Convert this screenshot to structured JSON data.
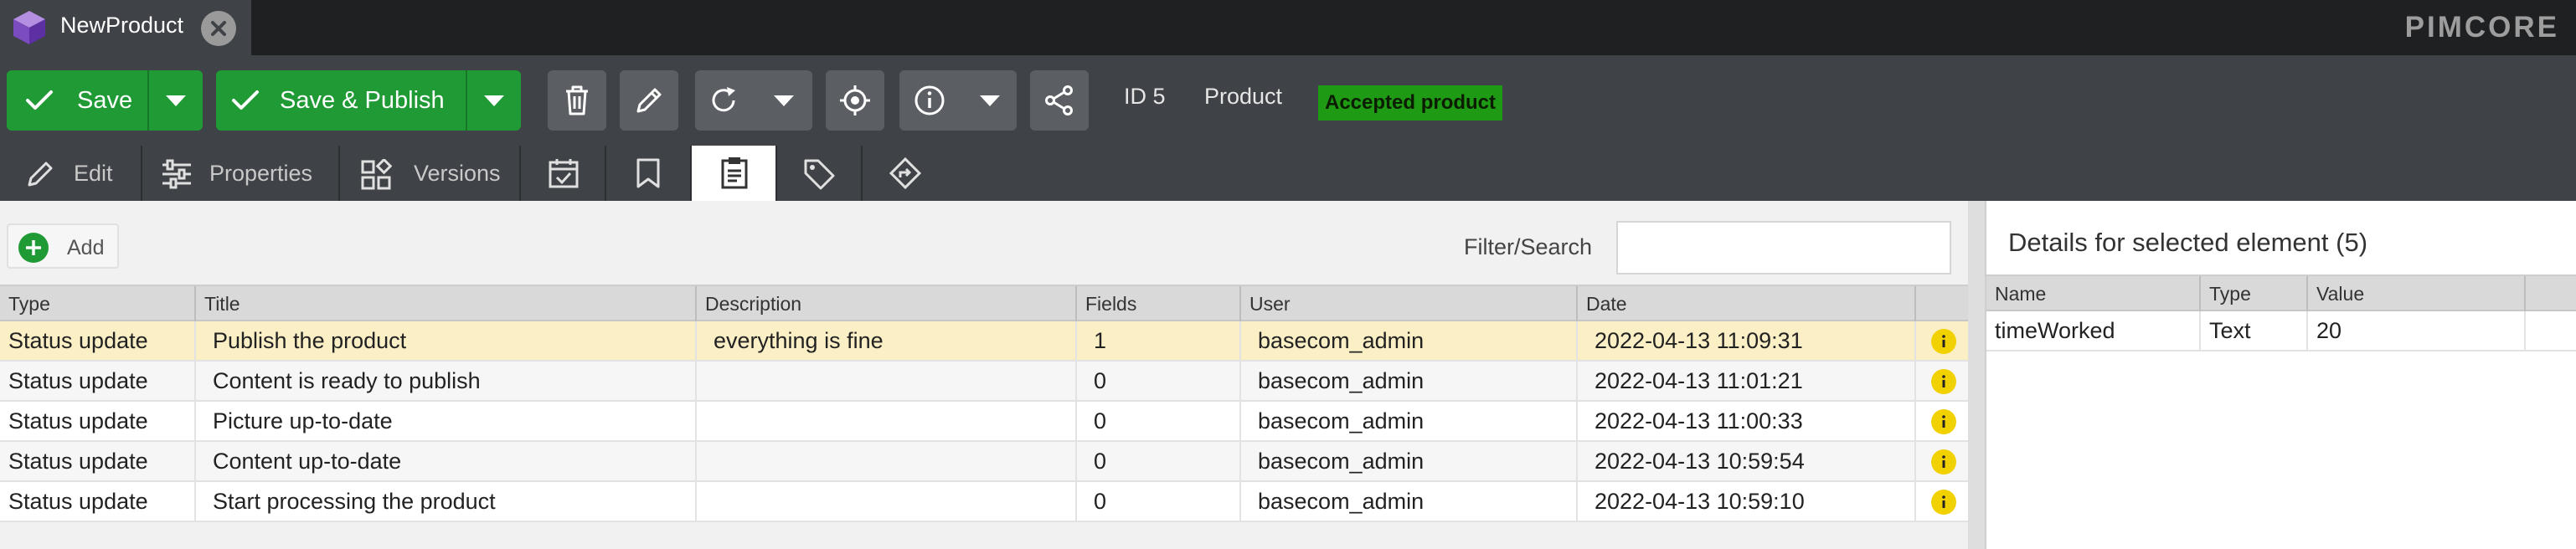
{
  "tab": {
    "title": "NewProduct",
    "icon": "cube-icon"
  },
  "brand": {
    "logo_text": "PIMCORE"
  },
  "toolbar": {
    "save_label": "Save",
    "save_publish_label": "Save & Publish",
    "id_label": "ID 5",
    "class_label": "Product",
    "status_badge": "Accepted product",
    "badge_color": "#1e9a14",
    "accent_color": "#1f9a35"
  },
  "subtabs": [
    {
      "label": "Edit",
      "icon": "pencil-icon"
    },
    {
      "label": "Properties",
      "icon": "sliders-icon"
    },
    {
      "label": "Versions",
      "icon": "versions-icon"
    },
    {
      "label": "",
      "icon": "calendar-check-icon"
    },
    {
      "label": "",
      "icon": "bookmark-icon"
    },
    {
      "label": "",
      "icon": "clipboard-icon"
    },
    {
      "label": "",
      "icon": "tag-icon"
    },
    {
      "label": "",
      "icon": "workflow-icon"
    }
  ],
  "notes": {
    "add_label": "Add",
    "filter_label": "Filter/Search",
    "filter_value": "",
    "columns": [
      "Type",
      "Title",
      "Description",
      "Fields",
      "User",
      "Date"
    ],
    "rows": [
      {
        "type": "Status update",
        "title": "Publish the product",
        "description": "everything is fine",
        "fields": "1",
        "user": "basecom_admin",
        "date": "2022-04-13 11:09:31"
      },
      {
        "type": "Status update",
        "title": "Content is ready to publish",
        "description": "",
        "fields": "0",
        "user": "basecom_admin",
        "date": "2022-04-13 11:01:21"
      },
      {
        "type": "Status update",
        "title": "Picture up-to-date",
        "description": "",
        "fields": "0",
        "user": "basecom_admin",
        "date": "2022-04-13 11:00:33"
      },
      {
        "type": "Status update",
        "title": "Content up-to-date",
        "description": "",
        "fields": "0",
        "user": "basecom_admin",
        "date": "2022-04-13 10:59:54"
      },
      {
        "type": "Status update",
        "title": "Start processing the product",
        "description": "",
        "fields": "0",
        "user": "basecom_admin",
        "date": "2022-04-13 10:59:10"
      }
    ]
  },
  "details": {
    "title": "Details for selected element (5)",
    "columns": [
      "Name",
      "Type",
      "Value"
    ],
    "rows": [
      {
        "name": "timeWorked",
        "type": "Text",
        "value": "20"
      }
    ]
  }
}
